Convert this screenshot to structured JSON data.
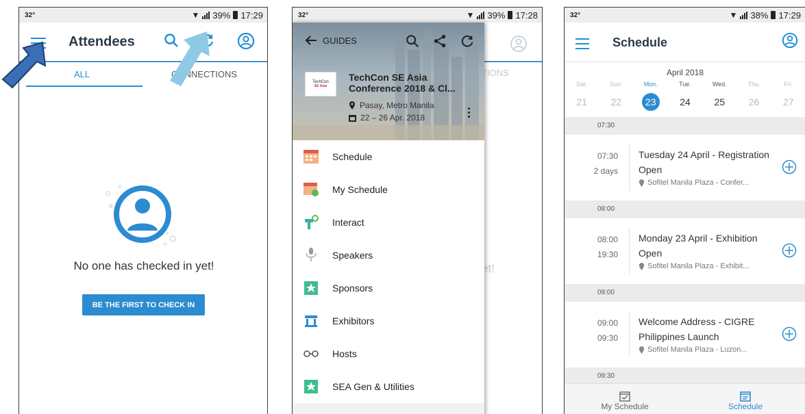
{
  "colors": {
    "accent": "#2d8bd1",
    "annotation_dark": "#3a6fb8",
    "annotation_light": "#8ec9e6"
  },
  "screen1": {
    "status": {
      "temp": "32°",
      "battery": "39%",
      "time": "17:29"
    },
    "title": "Attendees",
    "tabs": [
      "ALL",
      "CONNECTIONS"
    ],
    "empty_message": "No one has checked in yet!",
    "cta_label": "BE THE FIRST TO CHECK IN",
    "icons": [
      "menu-icon",
      "search-icon",
      "refresh-icon",
      "account-icon"
    ]
  },
  "screen2": {
    "status": {
      "temp": "32°",
      "battery": "39%",
      "time": "17:28"
    },
    "back_label": "GUIDES",
    "conference": {
      "logo_text": "TechCon",
      "logo_sub": "SE Asia",
      "title": "TechCon SE Asia Conference 2018 & Cl...",
      "location": "Pasay, Metro Manila",
      "dates": "22 – 26 Apr. 2018"
    },
    "menu": [
      {
        "label": "Schedule",
        "icon": "calendar-icon"
      },
      {
        "label": "My Schedule",
        "icon": "calendar-check-icon"
      },
      {
        "label": "Interact",
        "icon": "interact-icon"
      },
      {
        "label": "Speakers",
        "icon": "microphone-icon"
      },
      {
        "label": "Sponsors",
        "icon": "star-icon"
      },
      {
        "label": "Exhibitors",
        "icon": "booth-icon"
      },
      {
        "label": "Hosts",
        "icon": "glasses-icon"
      },
      {
        "label": "SEA Gen & Utilities",
        "icon": "star-icon"
      }
    ],
    "background_tab": "TIONS",
    "background_text": "et!"
  },
  "screen3": {
    "status": {
      "temp": "32°",
      "battery": "38%",
      "time": "17:29"
    },
    "title": "Schedule",
    "month": "April 2018",
    "week": [
      {
        "dow": "Sat.",
        "day": "21",
        "dim": true
      },
      {
        "dow": "Sun.",
        "day": "22",
        "dim": true
      },
      {
        "dow": "Mon.",
        "day": "23",
        "dim": false,
        "selected": true
      },
      {
        "dow": "Tue.",
        "day": "24",
        "dim": false
      },
      {
        "dow": "Wed.",
        "day": "25",
        "dim": false
      },
      {
        "dow": "Thu.",
        "day": "26",
        "dim": true
      },
      {
        "dow": "Fri.",
        "day": "27",
        "dim": true
      }
    ],
    "sections": [
      {
        "time": "07:30",
        "event": {
          "start": "07:30",
          "end": "2 days",
          "title": "Tuesday 24 April - Registration Open",
          "location": "Sofitel Manila Plaza - Confer..."
        }
      },
      {
        "time": "08:00",
        "event": {
          "start": "08:00",
          "end": "19:30",
          "title": "Monday 23 April - Exhibition Open",
          "location": "Sofitel Manila Plaza - Exhibit..."
        }
      },
      {
        "time": "09:00",
        "event": {
          "start": "09:00",
          "end": "09:30",
          "title": "Welcome Address - CIGRE Philippines Launch",
          "location": "Sofitel Manila Plaza - Luzon..."
        }
      },
      {
        "time": "09:30"
      }
    ],
    "bottom_nav": [
      "My Schedule",
      "Schedule"
    ]
  }
}
